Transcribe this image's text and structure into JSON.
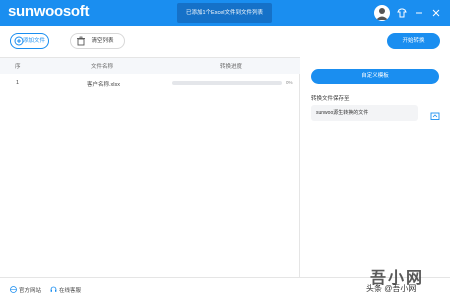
{
  "app": {
    "logo": "sunwoosoft",
    "notice": "已添加1个Excel文件到文件列表"
  },
  "titlebar": {
    "avatar_icon": "user-avatar-icon",
    "icons": [
      "shirt-icon",
      "minimize-icon",
      "close-icon"
    ]
  },
  "toolbar": {
    "add_label": "添加文件",
    "clear_label": "清空列表",
    "start_label": "开始转换"
  },
  "table": {
    "headers": [
      "序",
      "文件名称",
      "转换进度"
    ],
    "rows": [
      {
        "index": "1",
        "name": "客户名称.xlsx",
        "progress": 0,
        "percent": "0%"
      }
    ]
  },
  "right": {
    "custom_button": "自定义模板",
    "save_label": "转换文件保存至",
    "save_path": "sunwoo源生转换的文件"
  },
  "footer": {
    "site_link": "官方网站",
    "support_link": "在线客服"
  },
  "watermark": {
    "main": "吾小网",
    "sub": "头条 @吾小网"
  },
  "colors": {
    "primary": "#1a8ef0",
    "titlebar": "#1a8ef0",
    "notice_bg": "#1571c8"
  }
}
